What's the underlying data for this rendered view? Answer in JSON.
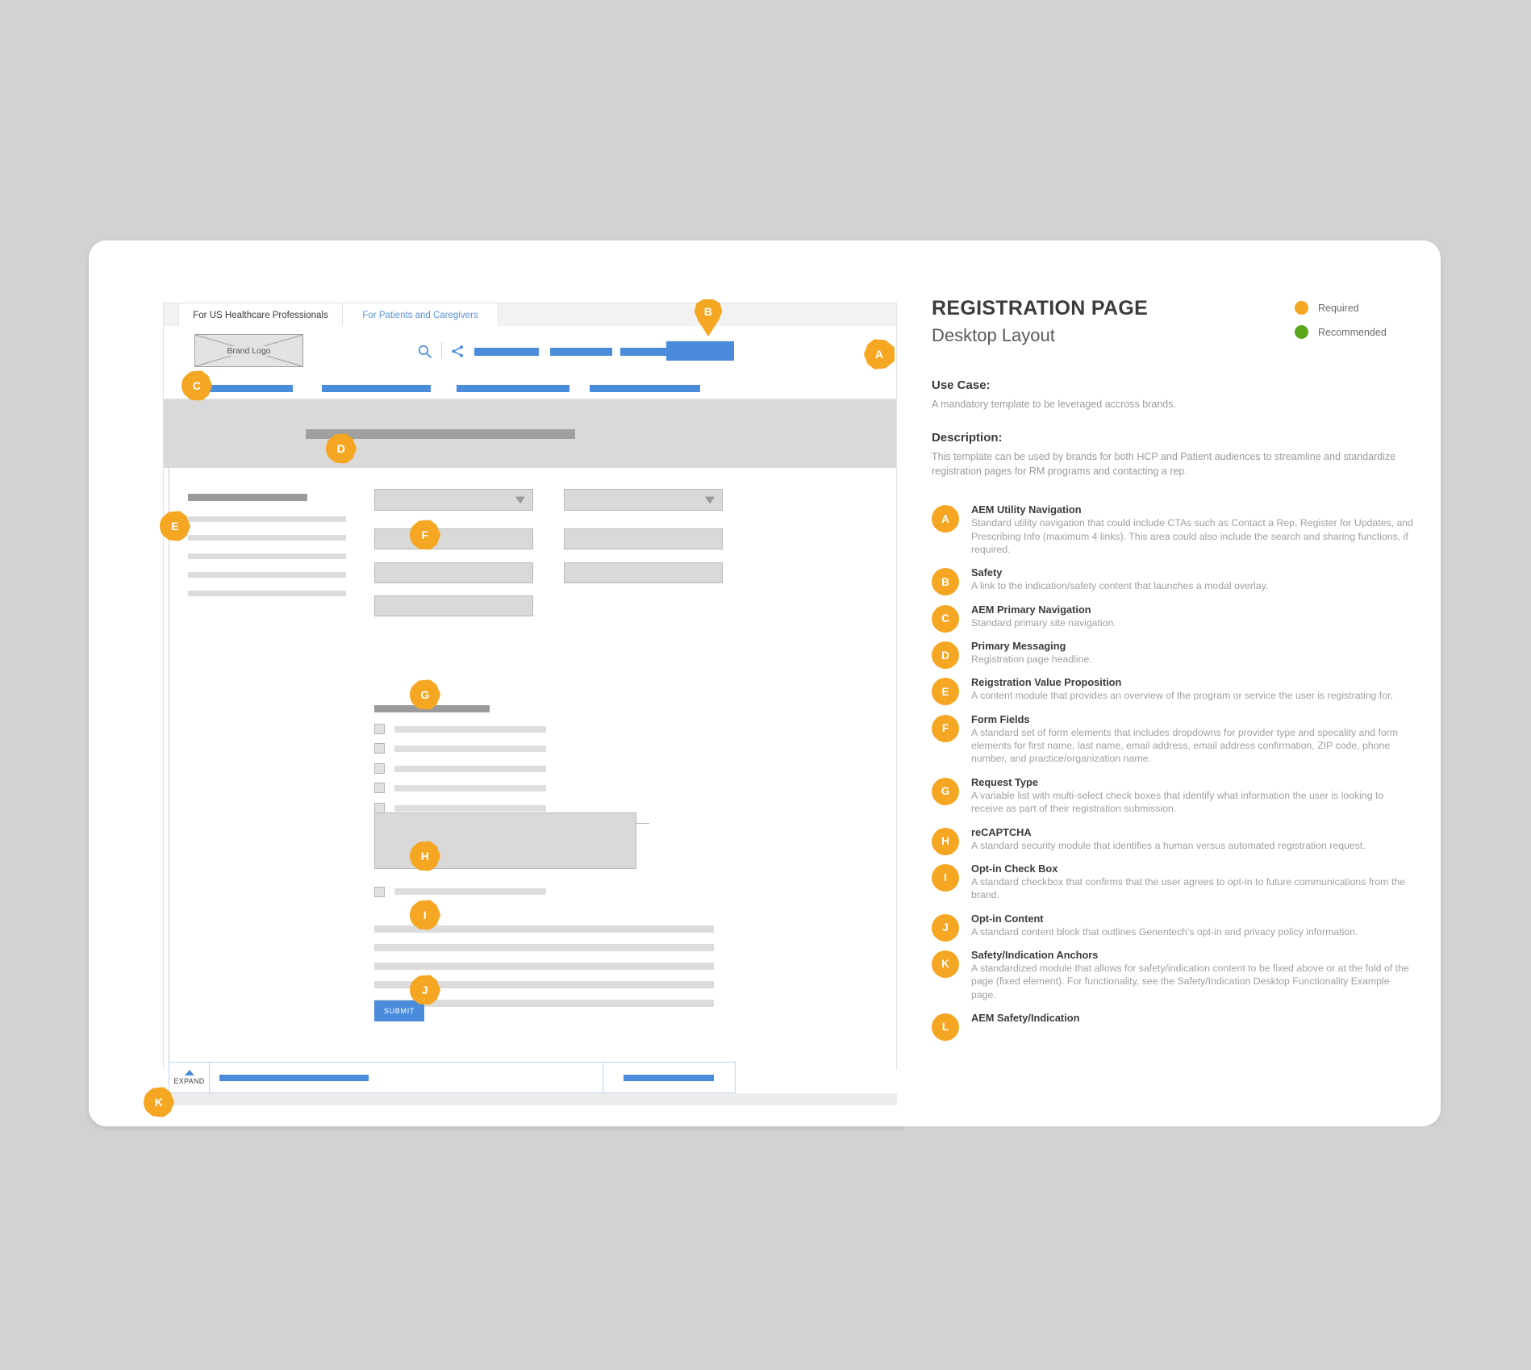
{
  "panel": {
    "title": "REGISTRATION PAGE",
    "subtitle": "Desktop Layout",
    "key": [
      {
        "label": "Required",
        "color": "#f5a623"
      },
      {
        "label": "Recommended",
        "color": "#5aa71c"
      }
    ],
    "usecase_heading": "Use Case:",
    "usecase_text": "A mandatory template to be leveraged accross brands.",
    "description_heading": "Description:",
    "description_text": "This template can be used by brands for both HCP and Patient audiences to streamline and standardize registration pages for RM programs and contacting a rep.",
    "legend": [
      {
        "letter": "A",
        "title": "AEM Utility Navigation",
        "desc": "Standard utility navigation that could include CTAs such as Contact a Rep, Register for Updates, and Prescribing Info (maximum 4 links). This area could also include the search and sharing functions, if required."
      },
      {
        "letter": "B",
        "title": "Safety",
        "desc": "A link to the indication/safety content that launches a modal overlay."
      },
      {
        "letter": "C",
        "title": "AEM Primary Navigation",
        "desc": "Standard primary site navigation."
      },
      {
        "letter": "D",
        "title": "Primary Messaging",
        "desc": "Registration page headline."
      },
      {
        "letter": "E",
        "title": "Reigstration Value Proposition",
        "desc": "A content module that provides an overview of the program or service the user is registrating for."
      },
      {
        "letter": "F",
        "title": "Form Fields",
        "desc": "A standard set of form elements that includes dropdowns for provider type and specality and form elements for first name, last name, email address, email address confirmation, ZIP code, phone number, and practice/organization name."
      },
      {
        "letter": "G",
        "title": "Request Type",
        "desc": "A variable list with multi-select check boxes that identify what information the user is looking to receive as part of their registration submission."
      },
      {
        "letter": "H",
        "title": "reCAPTCHA",
        "desc": "A standard security module that identifies a human versus automated registration request."
      },
      {
        "letter": "I",
        "title": "Opt-in Check Box",
        "desc": "A standard checkbox that confirms that the user agrees to opt-in to future communications from the brand."
      },
      {
        "letter": "J",
        "title": "Opt-in Content",
        "desc": "A standard content block that outlines Genentech's opt-in and privacy policy information."
      },
      {
        "letter": "K",
        "title": "Safety/Indication Anchors",
        "desc": "A standardized module that allows for safety/indication content to be fixed above or at the fold of the page (fixed element). For functionality, see the Safety/Indication Desktop Functionality Example page."
      },
      {
        "letter": "L",
        "title": "AEM Safety/Indication",
        "desc": ""
      }
    ]
  },
  "wireframe": {
    "audience_tabs": [
      {
        "label": "For US Healthcare Professionals",
        "active": true
      },
      {
        "label": "For Patients and Caregivers",
        "active": false
      }
    ],
    "brand_logo_label": "Brand Logo",
    "search_icon": "search-icon",
    "share_icon": "share-icon",
    "submit_label": "SUBMIT",
    "expand_label": "EXPAND",
    "accent_blue": "#4a8bdb",
    "marker_orange": "#f5a623",
    "markers": [
      {
        "letter": "A"
      },
      {
        "letter": "B"
      },
      {
        "letter": "C"
      },
      {
        "letter": "D"
      },
      {
        "letter": "E"
      },
      {
        "letter": "F"
      },
      {
        "letter": "G"
      },
      {
        "letter": "H"
      },
      {
        "letter": "I"
      },
      {
        "letter": "J"
      },
      {
        "letter": "K"
      }
    ]
  }
}
